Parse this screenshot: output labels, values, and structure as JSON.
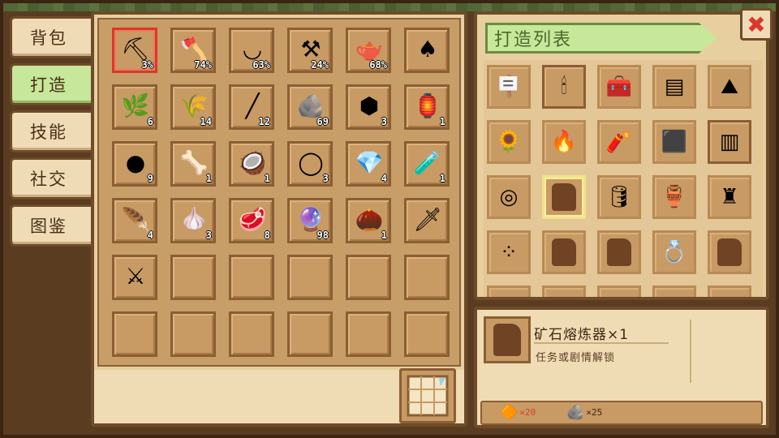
{
  "tabs": [
    {
      "label": "背包",
      "active": false
    },
    {
      "label": "打造",
      "active": true
    },
    {
      "label": "技能",
      "active": false
    },
    {
      "label": "社交",
      "active": false
    },
    {
      "label": "图鉴",
      "active": false
    }
  ],
  "inventory": {
    "rows": [
      [
        {
          "icon": "pickaxe-icon",
          "glyph": "⛏",
          "count": "3%",
          "selected": true
        },
        {
          "icon": "axe-icon",
          "glyph": "🪓",
          "count": "74%"
        },
        {
          "icon": "sickle-icon",
          "glyph": "◡",
          "count": "63%"
        },
        {
          "icon": "scythe-icon",
          "glyph": "⚒",
          "count": "24%"
        },
        {
          "icon": "watering-can-icon",
          "glyph": "🫖",
          "count": "68%"
        },
        {
          "icon": "shovel-icon",
          "glyph": "♠",
          "count": ""
        }
      ],
      [
        {
          "icon": "vine-icon",
          "glyph": "🌿",
          "count": "6"
        },
        {
          "icon": "wheat-icon",
          "glyph": "🌾",
          "count": "14"
        },
        {
          "icon": "stick-icon",
          "glyph": "╱",
          "count": "12"
        },
        {
          "icon": "stone-icon",
          "glyph": "🪨",
          "count": "69"
        },
        {
          "icon": "iron-ore-icon",
          "glyph": "⬢",
          "count": "3"
        },
        {
          "icon": "oil-lamp-icon",
          "glyph": "🏮",
          "count": "1"
        }
      ],
      [
        {
          "icon": "coal-icon",
          "glyph": "●",
          "count": "9"
        },
        {
          "icon": "branch-icon",
          "glyph": "🦴",
          "count": "1"
        },
        {
          "icon": "nut-icon",
          "glyph": "🥥",
          "count": "1"
        },
        {
          "icon": "white-stone-icon",
          "glyph": "◯",
          "count": "3"
        },
        {
          "icon": "blue-crystal-icon",
          "glyph": "💎",
          "count": "4"
        },
        {
          "icon": "tube-icon",
          "glyph": "🧪",
          "count": "1"
        }
      ],
      [
        {
          "icon": "feather-icon",
          "glyph": "🪶",
          "count": "4"
        },
        {
          "icon": "garlic-icon",
          "glyph": "🧄",
          "count": "3"
        },
        {
          "icon": "meat-icon",
          "glyph": "🥩",
          "count": "8"
        },
        {
          "icon": "purple-orb-icon",
          "glyph": "🔮",
          "count": "98"
        },
        {
          "icon": "acorn-icon",
          "glyph": "🌰",
          "count": "1"
        },
        {
          "icon": "gold-sword-icon",
          "glyph": "🗡",
          "count": ""
        }
      ],
      [
        {
          "icon": "blue-sword-icon",
          "glyph": "⚔",
          "count": ""
        },
        {
          "icon": "",
          "glyph": "",
          "count": ""
        },
        {
          "icon": "",
          "glyph": "",
          "count": ""
        },
        {
          "icon": "",
          "glyph": "",
          "count": ""
        },
        {
          "icon": "",
          "glyph": "",
          "count": ""
        },
        {
          "icon": "",
          "glyph": "",
          "count": ""
        }
      ],
      [
        {
          "icon": "",
          "glyph": "",
          "count": ""
        },
        {
          "icon": "",
          "glyph": "",
          "count": ""
        },
        {
          "icon": "",
          "glyph": "",
          "count": ""
        },
        {
          "icon": "",
          "glyph": "",
          "count": ""
        },
        {
          "icon": "",
          "glyph": "",
          "count": ""
        },
        {
          "icon": "",
          "glyph": "",
          "count": ""
        }
      ]
    ]
  },
  "craft": {
    "title": "打造列表",
    "rows": [
      [
        {
          "icon": "signpost-icon",
          "glyph": "🪧"
        },
        {
          "icon": "torch-icon",
          "glyph": "🕯",
          "highlight": true
        },
        {
          "icon": "chest-icon",
          "glyph": "🧰"
        },
        {
          "icon": "wood-plank-icon",
          "glyph": "▤"
        },
        {
          "icon": "ore-pile-icon",
          "glyph": "⛰"
        }
      ],
      [
        {
          "icon": "scarecrow-icon",
          "glyph": "🌻"
        },
        {
          "icon": "campfire-icon",
          "glyph": "🔥"
        },
        {
          "icon": "dynamite-icon",
          "glyph": "🧨"
        },
        {
          "icon": "furnace-icon",
          "glyph": "⬛"
        },
        {
          "icon": "fence-icon",
          "glyph": "▥",
          "highlight": true
        }
      ],
      [
        {
          "icon": "ring-icon",
          "glyph": "◎"
        },
        {
          "icon": "ore-smelter-icon",
          "glyph": "",
          "locked": true,
          "selected": true
        },
        {
          "icon": "barrel-icon",
          "glyph": "🛢"
        },
        {
          "icon": "green-pot-icon",
          "glyph": "🏺"
        },
        {
          "icon": "statue-icon",
          "glyph": "♜"
        }
      ],
      [
        {
          "icon": "stone-path-icon",
          "glyph": "⁘"
        },
        {
          "icon": "locked-item-icon",
          "glyph": "",
          "locked": true
        },
        {
          "icon": "locked-item-icon",
          "glyph": "",
          "locked": true
        },
        {
          "icon": "gem-ring-icon",
          "glyph": "💍"
        },
        {
          "icon": "locked-item-icon",
          "glyph": "",
          "locked": true
        }
      ]
    ]
  },
  "detail": {
    "name": "矿石熔炼器×1",
    "desc": "任务或剧情解锁",
    "materials": [
      {
        "icon": "copper-ore-icon",
        "glyph": "🔶",
        "qty": "×20",
        "color": "#e03a2a"
      },
      {
        "icon": "stone-icon",
        "glyph": "🪨",
        "qty": "×25",
        "color": "#3a2412"
      }
    ]
  },
  "close_glyph": "✖",
  "colors": {
    "selected_border": "#d8392b",
    "active_tab": "#c7e79a"
  }
}
